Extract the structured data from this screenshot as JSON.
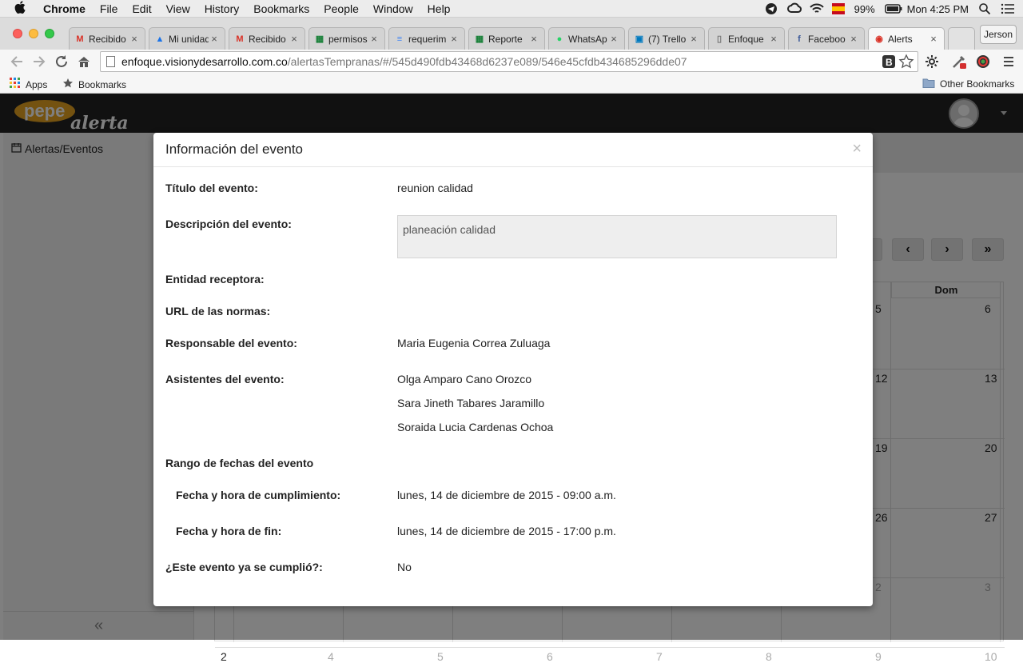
{
  "menubar": {
    "app_name": "Chrome",
    "items": [
      "File",
      "Edit",
      "View",
      "History",
      "Bookmarks",
      "People",
      "Window",
      "Help"
    ],
    "battery": "99%",
    "clock": "Mon 4:25 PM"
  },
  "browser": {
    "tabs": [
      {
        "label": "Recibido",
        "icon": "gmail-icon",
        "color": "#d93025"
      },
      {
        "label": "Mi unidad",
        "icon": "drive-icon",
        "color": "#1a73e8"
      },
      {
        "label": "Recibido",
        "icon": "gmail-icon",
        "color": "#d93025"
      },
      {
        "label": "permisos",
        "icon": "sheets-icon",
        "color": "#188038"
      },
      {
        "label": "requerim",
        "icon": "docs-icon",
        "color": "#4285f4"
      },
      {
        "label": "Reporte",
        "icon": "sheets-icon",
        "color": "#188038"
      },
      {
        "label": "WhatsAp",
        "icon": "whatsapp-icon",
        "color": "#25d366"
      },
      {
        "label": "(7) Trello",
        "icon": "trello-icon",
        "color": "#0079bf"
      },
      {
        "label": "Enfoque",
        "icon": "page-icon",
        "color": "#777777"
      },
      {
        "label": "Faceboo",
        "icon": "facebook-icon",
        "color": "#3b5998"
      },
      {
        "label": "Alerts",
        "icon": "alert-icon",
        "color": "#d93025"
      }
    ],
    "profile_name": "Jerson",
    "url_host": "enfoque.visionydesarrollo.com.co",
    "url_path": "/alertasTempranas/#/545d490fdb43468d6237e089/546e45cfdb434685296dde07",
    "bookmarks": {
      "apps": "Apps",
      "bookmarks": "Bookmarks",
      "other": "Other Bookmarks"
    }
  },
  "app": {
    "logo_top": "pepe",
    "logo_bottom": "alerta",
    "sidebar_item": "Alertas/Eventos",
    "collapse_glyph": "«"
  },
  "calendar": {
    "header_day": "Dom",
    "nav": [
      "‹",
      "›",
      "»"
    ],
    "right_col1": [
      "5",
      "12",
      "19",
      "26",
      "2"
    ],
    "right_col2": [
      "6",
      "13",
      "20",
      "27",
      "3"
    ],
    "bottom_row": [
      "2",
      "4",
      "5",
      "6",
      "7",
      "8",
      "9",
      "10"
    ]
  },
  "modal": {
    "title": "Información del evento",
    "close": "×",
    "fields": {
      "titulo_label": "Título del evento:",
      "titulo_value": "reunion calidad",
      "descripcion_label": "Descripción del evento:",
      "descripcion_value": "planeación calidad",
      "entidad_label": "Entidad receptora:",
      "url_label": "URL de las normas:",
      "responsable_label": "Responsable del evento:",
      "responsable_value": "Maria Eugenia Correa Zuluaga",
      "asistentes_label": "Asistentes del evento:",
      "asistentes": [
        "Olga Amparo Cano Orozco",
        "Sara Jineth Tabares Jaramillo",
        "Soraida Lucia Cardenas Ochoa"
      ],
      "rango_label": "Rango de fechas del evento",
      "cumplimiento_label": "Fecha y hora de cumplimiento:",
      "cumplimiento_value": "lunes, 14 de diciembre de 2015 - 09:00 a.m.",
      "fin_label": "Fecha y hora de fin:",
      "fin_value": "lunes, 14 de diciembre de 2015 - 17:00 p.m.",
      "cumplido_label": "¿Este evento ya se cumplió?:",
      "cumplido_value": "No"
    }
  }
}
